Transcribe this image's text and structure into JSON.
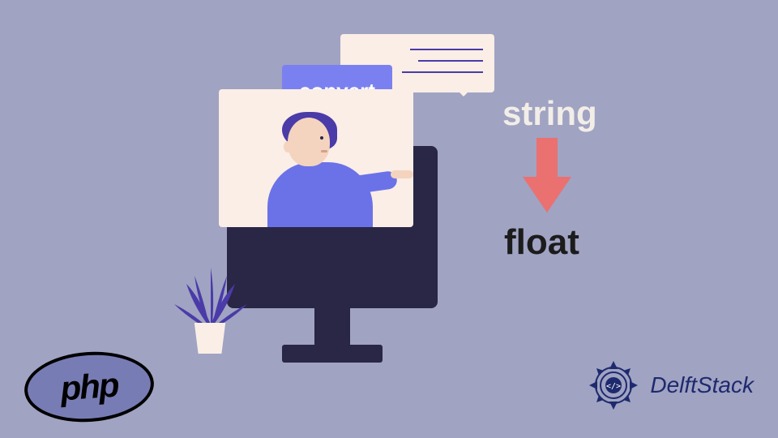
{
  "bubble": {
    "convert_label": "convert"
  },
  "labels": {
    "string": "string",
    "float": "float"
  },
  "logos": {
    "php": "php",
    "delft": "DelftStack"
  }
}
